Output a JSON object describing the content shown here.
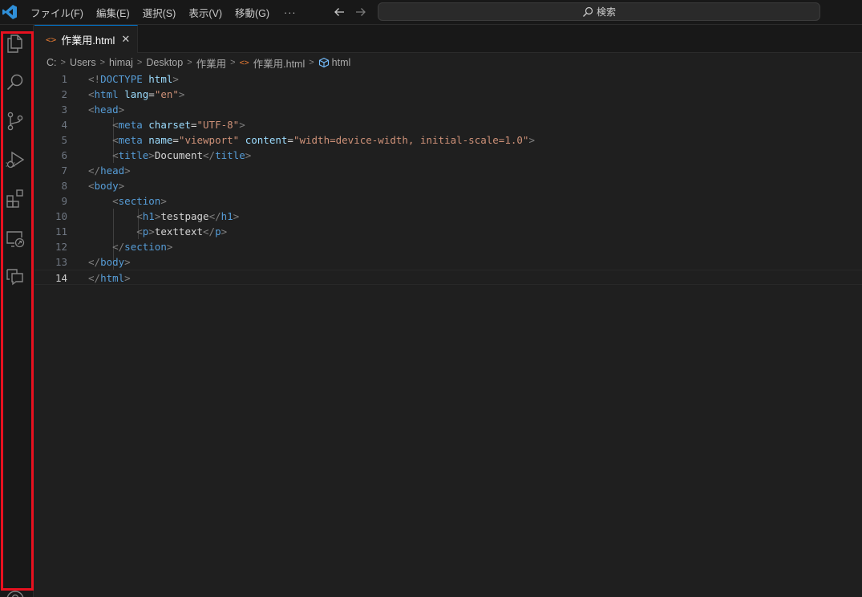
{
  "colors": {
    "accent": "#0078d4",
    "highlight_box": "#e8111f",
    "tag": "#569cd6",
    "attr": "#9cdcfe",
    "string": "#ce9178",
    "punct": "#808080",
    "text": "#d4d4d4"
  },
  "menu": {
    "items": [
      "ファイル(F)",
      "編集(E)",
      "選択(S)",
      "表示(V)",
      "移動(G)"
    ],
    "more": "···"
  },
  "search": {
    "label": "検索"
  },
  "activity_bar": {
    "icons": [
      "explorer-icon",
      "search-icon",
      "source-control-icon",
      "run-debug-icon",
      "extensions-icon",
      "remote-explorer-icon",
      "chat-icon",
      "account-icon"
    ]
  },
  "tab": {
    "label": "作業用.html",
    "close": "✕"
  },
  "breadcrumb": {
    "drive": "C:",
    "parts": [
      "Users",
      "himaj",
      "Desktop",
      "作業用"
    ],
    "file": "作業用.html",
    "symbol": "html"
  },
  "editor": {
    "active_line": 14,
    "lines": [
      {
        "n": "1",
        "tokens": [
          [
            "punc",
            "<!"
          ],
          [
            "tag",
            "DOCTYPE"
          ],
          [
            "text",
            " "
          ],
          [
            "attr",
            "html"
          ],
          [
            "punc",
            ">"
          ]
        ]
      },
      {
        "n": "2",
        "tokens": [
          [
            "punc",
            "<"
          ],
          [
            "tag",
            "html"
          ],
          [
            "text",
            " "
          ],
          [
            "attr",
            "lang"
          ],
          [
            "text",
            "="
          ],
          [
            "str",
            "\"en\""
          ],
          [
            "punc",
            ">"
          ]
        ]
      },
      {
        "n": "3",
        "tokens": [
          [
            "punc",
            "<"
          ],
          [
            "tag",
            "head"
          ],
          [
            "punc",
            ">"
          ]
        ]
      },
      {
        "n": "4",
        "tokens": [
          [
            "text",
            "    "
          ],
          [
            "punc",
            "<"
          ],
          [
            "tag",
            "meta"
          ],
          [
            "text",
            " "
          ],
          [
            "attr",
            "charset"
          ],
          [
            "text",
            "="
          ],
          [
            "str",
            "\"UTF-8\""
          ],
          [
            "punc",
            ">"
          ]
        ]
      },
      {
        "n": "5",
        "tokens": [
          [
            "text",
            "    "
          ],
          [
            "punc",
            "<"
          ],
          [
            "tag",
            "meta"
          ],
          [
            "text",
            " "
          ],
          [
            "attr",
            "name"
          ],
          [
            "text",
            "="
          ],
          [
            "str",
            "\"viewport\""
          ],
          [
            "text",
            " "
          ],
          [
            "attr",
            "content"
          ],
          [
            "text",
            "="
          ],
          [
            "str",
            "\"width=device-width, initial-scale=1.0\""
          ],
          [
            "punc",
            ">"
          ]
        ]
      },
      {
        "n": "6",
        "tokens": [
          [
            "text",
            "    "
          ],
          [
            "punc",
            "<"
          ],
          [
            "tag",
            "title"
          ],
          [
            "punc",
            ">"
          ],
          [
            "text",
            "Document"
          ],
          [
            "punc",
            "</"
          ],
          [
            "tag",
            "title"
          ],
          [
            "punc",
            ">"
          ]
        ]
      },
      {
        "n": "7",
        "tokens": [
          [
            "punc",
            "</"
          ],
          [
            "tag",
            "head"
          ],
          [
            "punc",
            ">"
          ]
        ]
      },
      {
        "n": "8",
        "tokens": [
          [
            "punc",
            "<"
          ],
          [
            "tag",
            "body"
          ],
          [
            "punc",
            ">"
          ]
        ]
      },
      {
        "n": "9",
        "tokens": [
          [
            "text",
            "    "
          ],
          [
            "punc",
            "<"
          ],
          [
            "tag",
            "section"
          ],
          [
            "punc",
            ">"
          ]
        ]
      },
      {
        "n": "10",
        "tokens": [
          [
            "text",
            "        "
          ],
          [
            "punc",
            "<"
          ],
          [
            "tag",
            "h1"
          ],
          [
            "punc",
            ">"
          ],
          [
            "text",
            "testpage"
          ],
          [
            "punc",
            "</"
          ],
          [
            "tag",
            "h1"
          ],
          [
            "punc",
            ">"
          ]
        ]
      },
      {
        "n": "11",
        "tokens": [
          [
            "text",
            "        "
          ],
          [
            "punc",
            "<"
          ],
          [
            "tag",
            "p"
          ],
          [
            "punc",
            ">"
          ],
          [
            "text",
            "texttext"
          ],
          [
            "punc",
            "</"
          ],
          [
            "tag",
            "p"
          ],
          [
            "punc",
            ">"
          ]
        ]
      },
      {
        "n": "12",
        "tokens": [
          [
            "text",
            "    "
          ],
          [
            "punc",
            "</"
          ],
          [
            "tag",
            "section"
          ],
          [
            "punc",
            ">"
          ]
        ]
      },
      {
        "n": "13",
        "tokens": [
          [
            "punc",
            "</"
          ],
          [
            "tag",
            "body"
          ],
          [
            "punc",
            ">"
          ]
        ]
      },
      {
        "n": "14",
        "tokens": [
          [
            "punc",
            "</"
          ],
          [
            "tag",
            "html"
          ],
          [
            "punc",
            ">"
          ]
        ]
      }
    ]
  }
}
